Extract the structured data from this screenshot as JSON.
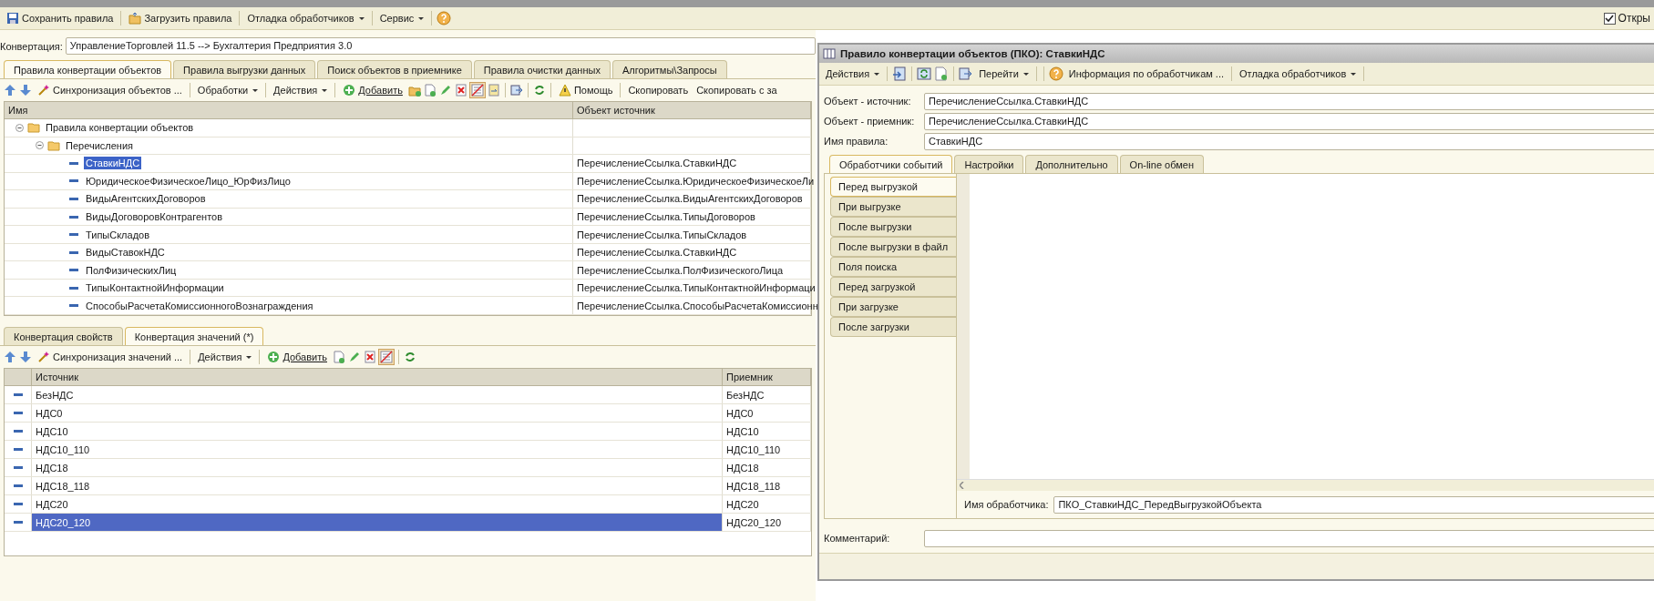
{
  "toolbar": [
    {
      "label": "Сохранить правила",
      "kind": "button"
    },
    {
      "label": "Загрузить правила",
      "kind": "button"
    },
    {
      "label": "Отладка обработчиков",
      "kind": "menu"
    },
    {
      "label": "Сервис",
      "kind": "menu"
    }
  ],
  "open_checkbox": {
    "label": "Откры",
    "checked": true
  },
  "conversion": {
    "label": "Конвертация:",
    "value": "УправлениеТорговлей 11.5 --> Бухгалтерия Предприятия 3.0"
  },
  "tabs": [
    {
      "label": "Правила конвертации объектов",
      "selected": true
    },
    {
      "label": "Правила выгрузки данных",
      "selected": false
    },
    {
      "label": "Поиск объектов в приемнике",
      "selected": false
    },
    {
      "label": "Правила очистки данных",
      "selected": false
    },
    {
      "label": "Алгоритмы\\Запросы",
      "selected": false
    }
  ],
  "rules_toolbar": [
    {
      "label": "Синхронизация объектов ...",
      "kind": "button"
    },
    {
      "label": "Обработки",
      "kind": "menu"
    },
    {
      "label": "Действия",
      "kind": "menu"
    },
    {
      "label": "Добавить",
      "kind": "button"
    },
    {
      "label": "Помощь",
      "kind": "button"
    },
    {
      "label": "Скопировать",
      "kind": "button"
    },
    {
      "label": "Скопировать с за",
      "kind": "button"
    }
  ],
  "tree": {
    "columns": [
      "Имя",
      "Объект источник"
    ],
    "rows": [
      {
        "name": "Правила конвертации объектов",
        "expanded": true,
        "selected": false,
        "children": [
          {
            "name": "Перечисления",
            "expanded": true,
            "selected": false,
            "children": [
              {
                "name": "СтавкиНДС",
                "source": "ПеречислениеСсылка.СтавкиНДС",
                "selected": true
              },
              {
                "name": "ЮридическоеФизическоеЛицо_ЮрФизЛицо",
                "source": "ПеречислениеСсылка.ЮридическоеФизическоеЛи",
                "selected": false
              },
              {
                "name": "ВидыАгентскихДоговоров",
                "source": "ПеречислениеСсылка.ВидыАгентскихДоговоров",
                "selected": false
              },
              {
                "name": "ВидыДоговоровКонтрагентов",
                "source": "ПеречислениеСсылка.ТипыДоговоров",
                "selected": false
              },
              {
                "name": "ТипыСкладов",
                "source": "ПеречислениеСсылка.ТипыСкладов",
                "selected": false
              },
              {
                "name": "ВидыСтавокНДС",
                "source": "ПеречислениеСсылка.СтавкиНДС",
                "selected": false
              },
              {
                "name": "ПолФизическихЛиц",
                "source": "ПеречислениеСсылка.ПолФизическогоЛица",
                "selected": false
              },
              {
                "name": "ТипыКонтактнойИнформации",
                "source": "ПеречислениеСсылка.ТипыКонтактнойИнформаци",
                "selected": false
              },
              {
                "name": "СпособыРасчетаКомиссионногоВознаграждения",
                "source": "ПеречислениеСсылка.СпособыРасчетаКомиссионн",
                "selected": false
              }
            ]
          }
        ]
      }
    ]
  },
  "lower_tabs": [
    {
      "label": "Конвертация свойств",
      "selected": false
    },
    {
      "label": "Конвертация значений (*)",
      "selected": true
    }
  ],
  "values_toolbar": [
    {
      "label": "Синхронизация значений ...",
      "kind": "button"
    },
    {
      "label": "Действия",
      "kind": "menu"
    },
    {
      "label": "Добавить",
      "kind": "button"
    }
  ],
  "values_table": {
    "columns": [
      "Источник",
      "Приемник"
    ],
    "rows": [
      {
        "source": "БезНДС",
        "target": "БезНДС",
        "selected": false
      },
      {
        "source": "НДС0",
        "target": "НДС0",
        "selected": false
      },
      {
        "source": "НДС10",
        "target": "НДС10",
        "selected": false
      },
      {
        "source": "НДС10_110",
        "target": "НДС10_110",
        "selected": false
      },
      {
        "source": "НДС18",
        "target": "НДС18",
        "selected": false
      },
      {
        "source": "НДС18_118",
        "target": "НДС18_118",
        "selected": false
      },
      {
        "source": "НДС20",
        "target": "НДС20",
        "selected": false
      },
      {
        "source": "НДС20_120",
        "target": "НДС20_120",
        "selected": true
      }
    ]
  },
  "dialog": {
    "title": "Правило конвертации объектов (ПКО): СтавкиНДС",
    "toolbar": [
      {
        "label": "Действия",
        "kind": "menu"
      },
      {
        "label": "Перейти",
        "kind": "menu"
      },
      {
        "label": "Информация по обработчикам ...",
        "kind": "button"
      },
      {
        "label": "Отладка обработчиков",
        "kind": "menu"
      }
    ],
    "fields": [
      {
        "label": "Объект - источник:",
        "value": "ПеречислениеСсылка.СтавкиНДС"
      },
      {
        "label": "Объект - приемник:",
        "value": "ПеречислениеСсылка.СтавкиНДС"
      },
      {
        "label": "Имя правила:",
        "value": "СтавкиНДС"
      }
    ],
    "tabs": [
      {
        "label": "Обработчики событий",
        "selected": true
      },
      {
        "label": "Настройки",
        "selected": false
      },
      {
        "label": "Дополнительно",
        "selected": false
      },
      {
        "label": "On-line обмен",
        "selected": false
      }
    ],
    "event_tabs": [
      {
        "label": "Перед выгрузкой",
        "selected": true
      },
      {
        "label": "При выгрузке",
        "selected": false
      },
      {
        "label": "После выгрузки",
        "selected": false
      },
      {
        "label": "После выгрузки в файл",
        "selected": false
      },
      {
        "label": "Поля поиска",
        "selected": false
      },
      {
        "label": "Перед загрузкой",
        "selected": false
      },
      {
        "label": "При загрузке",
        "selected": false
      },
      {
        "label": "После загрузки",
        "selected": false
      }
    ],
    "handler": {
      "label": "Имя обработчика:",
      "value": "ПКО_СтавкиНДС_ПередВыгрузкойОбъекта"
    },
    "comment": {
      "label": "Комментарий:"
    }
  }
}
